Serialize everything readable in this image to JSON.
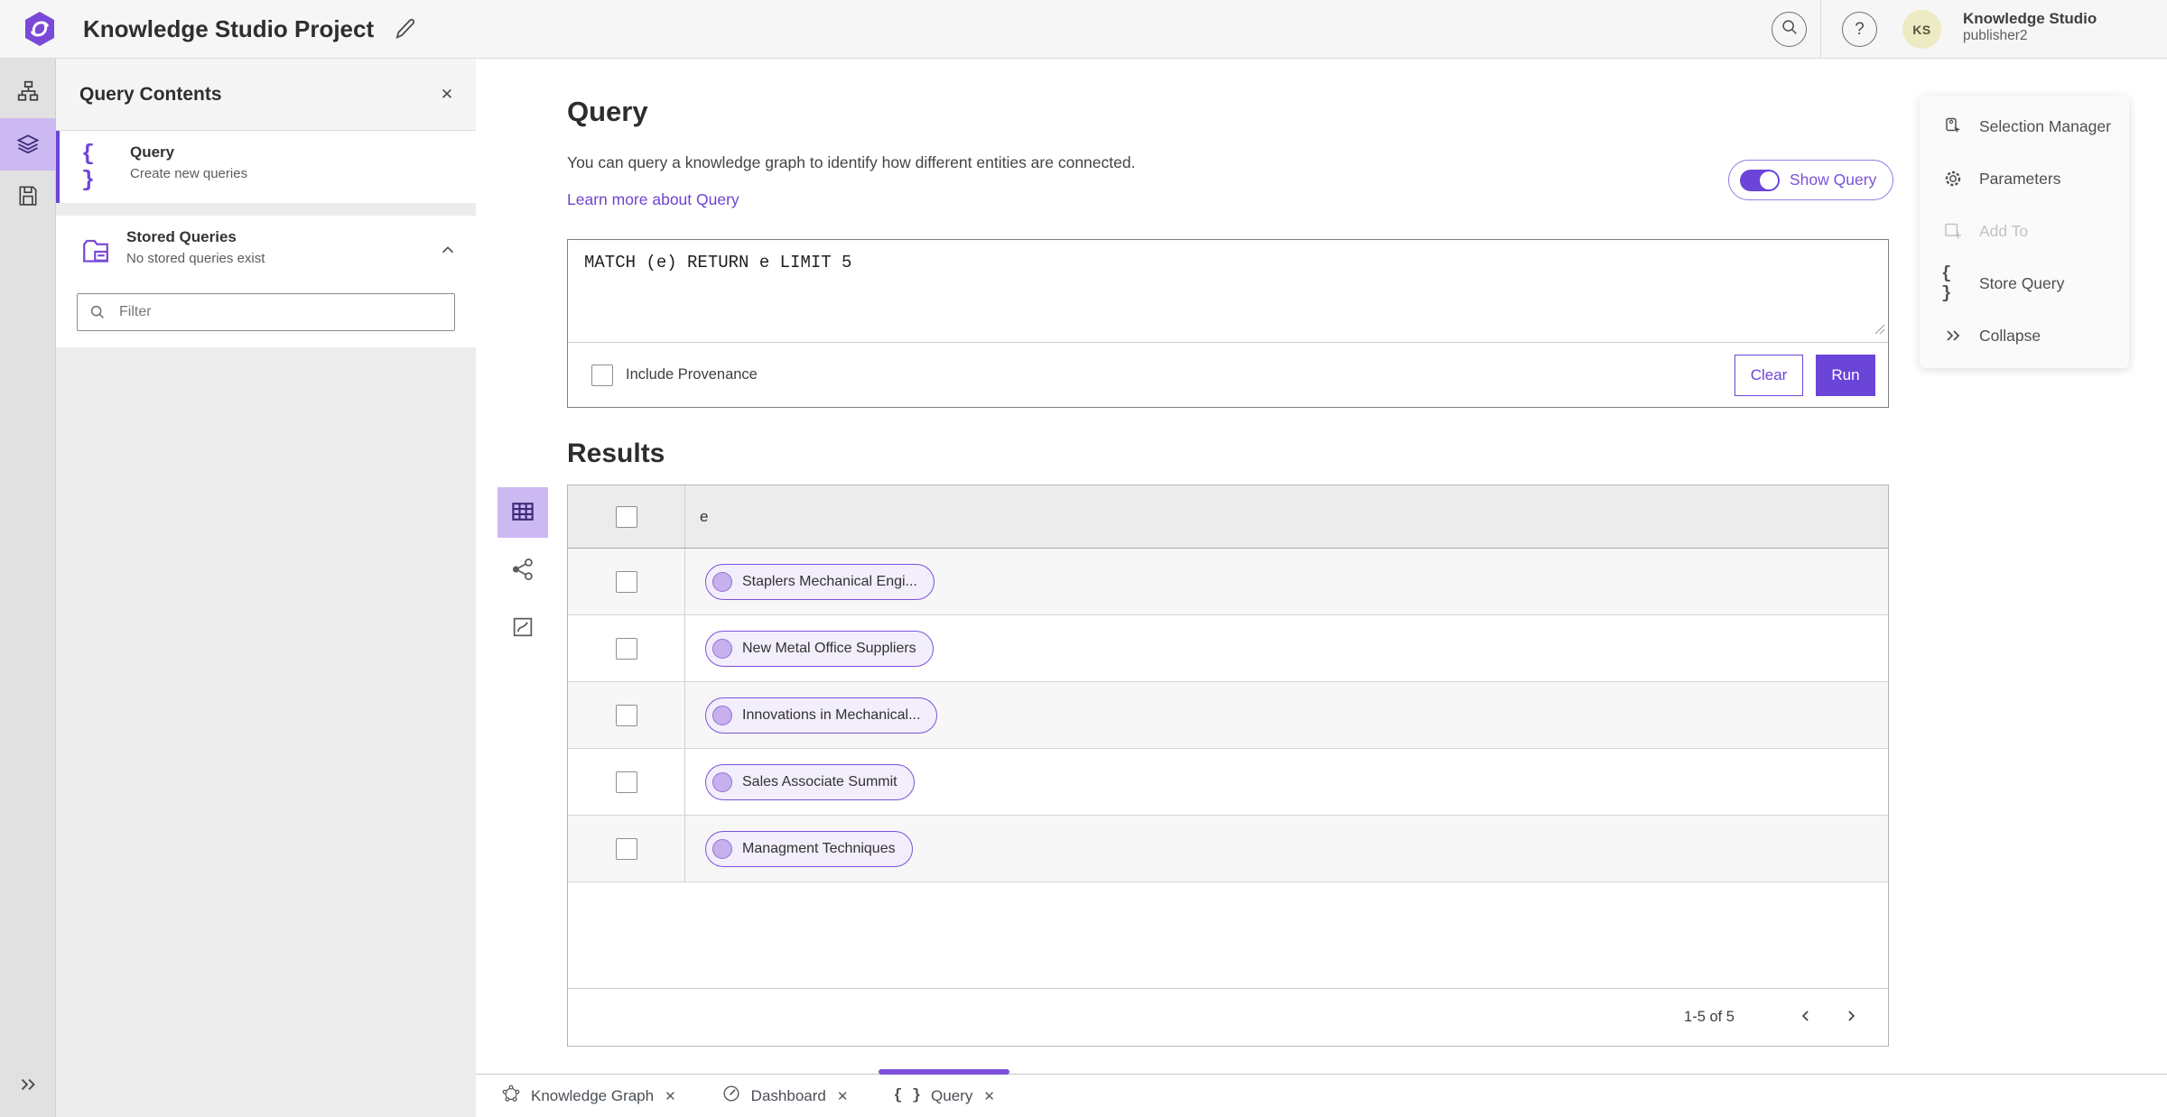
{
  "header": {
    "app_title": "Knowledge Studio Project",
    "account": {
      "initials": "KS",
      "name": "Knowledge Studio",
      "role": "publisher2"
    }
  },
  "icons": {
    "close": "✕",
    "help": "?",
    "braces": "{ }"
  },
  "contents_panel": {
    "title": "Query Contents",
    "items": [
      {
        "title": "Query",
        "description": "Create new queries"
      },
      {
        "title": "Stored Queries",
        "description": "No stored queries exist"
      }
    ],
    "filter_placeholder": "Filter"
  },
  "query_panel": {
    "heading": "Query",
    "description": "You can query a knowledge graph to identify how different entities are connected.",
    "learn_more_label": "Learn more about Query",
    "show_query_label": "Show Query",
    "query_text": "MATCH (e) RETURN e LIMIT 5",
    "include_provenance_label": "Include Provenance",
    "clear_label": "Clear",
    "run_label": "Run"
  },
  "results": {
    "heading": "Results",
    "column_header": "e",
    "rows": [
      {
        "label": "Staplers Mechanical Engi..."
      },
      {
        "label": "New Metal Office Suppliers"
      },
      {
        "label": "Innovations in Mechanical..."
      },
      {
        "label": "Sales Associate Summit"
      },
      {
        "label": "Managment Techniques"
      }
    ],
    "pagination": {
      "range_label": "1-5 of 5"
    }
  },
  "tools_panel": {
    "items": [
      {
        "label": "Selection Manager"
      },
      {
        "label": "Parameters"
      },
      {
        "label": "Add To"
      },
      {
        "label": "Store Query"
      },
      {
        "label": "Collapse"
      }
    ]
  },
  "tab_bar": {
    "tabs": [
      {
        "label": "Knowledge Graph"
      },
      {
        "label": "Dashboard"
      },
      {
        "label": "Query"
      }
    ]
  },
  "colors": {
    "accent": "#6b44d8",
    "accent_light": "#cdb9f2",
    "link": "#6e46cc",
    "pill_bg": "#f3eefc",
    "pill_border": "#7b52d9",
    "pill_dot": "#c7b0ee",
    "pill_dot_border": "#9273cf",
    "avatar_bg": "#ecebc4",
    "tab_active": "#7a52dd"
  }
}
